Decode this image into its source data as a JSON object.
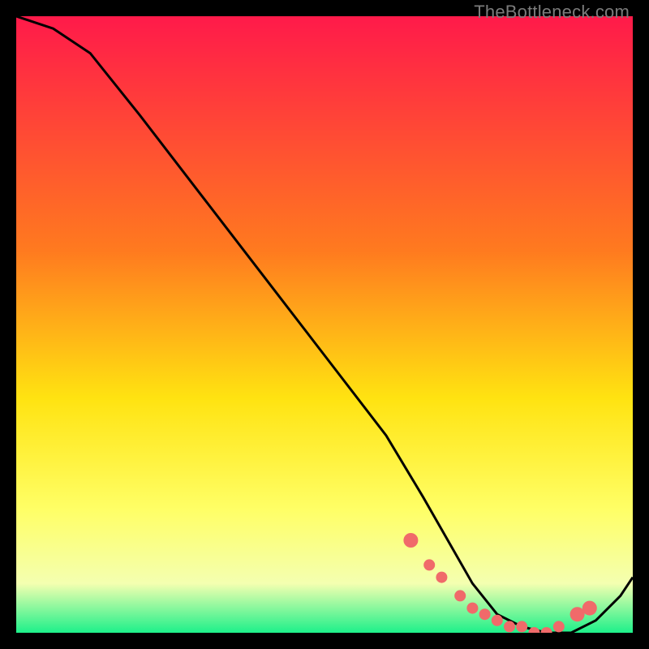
{
  "watermark": "TheBottleneck.com",
  "colors": {
    "top": "#ff1a4a",
    "mid1": "#ff7a1f",
    "mid2": "#ffe311",
    "mid3": "#ffff66",
    "mid4": "#f4ffb0",
    "bottom": "#1df08a",
    "dot": "#f06a6a",
    "line": "#000000",
    "frame": "#000000"
  },
  "chart_data": {
    "type": "line",
    "title": "",
    "xlabel": "",
    "ylabel": "",
    "xlim": [
      0,
      100
    ],
    "ylim": [
      0,
      100
    ],
    "series": [
      {
        "name": "bottleneck-curve",
        "x": [
          0,
          6,
          12,
          20,
          30,
          40,
          50,
          60,
          66,
          70,
          74,
          78,
          82,
          86,
          90,
          94,
          98,
          100
        ],
        "values": [
          100,
          98,
          94,
          84,
          71,
          58,
          45,
          32,
          22,
          15,
          8,
          3,
          1,
          0,
          0,
          2,
          6,
          9
        ]
      }
    ],
    "markers": {
      "name": "highlight-dots",
      "x": [
        64,
        67,
        69,
        72,
        74,
        76,
        78,
        80,
        82,
        84,
        86,
        88,
        91,
        93
      ],
      "values": [
        15,
        11,
        9,
        6,
        4,
        3,
        2,
        1,
        1,
        0,
        0,
        1,
        3,
        4
      ]
    }
  }
}
